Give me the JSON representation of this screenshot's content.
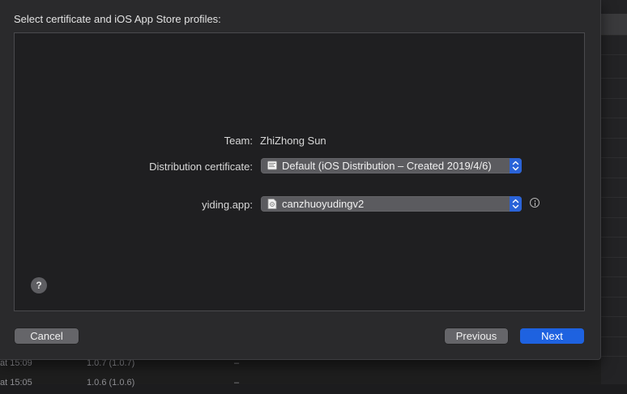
{
  "background_list": {
    "rows": [
      {
        "date": "at 15:09",
        "version": "1.0.7 (1.0.7)",
        "status": "–"
      },
      {
        "date": "at 15:05",
        "version": "1.0.6 (1.0.6)",
        "status": "–"
      }
    ]
  },
  "sheet": {
    "title": "Select certificate and iOS App Store profiles:",
    "team": {
      "label": "Team:",
      "value": "ZhiZhong Sun"
    },
    "distribution_certificate": {
      "label": "Distribution certificate:",
      "value": "Default (iOS Distribution – Created 2019/4/6)",
      "icon": "certificate-icon"
    },
    "app_profile": {
      "label": "yiding.app:",
      "value": "canzhuoyudingv2",
      "icon": "provisioning-profile-icon",
      "info_icon": "info-icon"
    },
    "help_label": "?",
    "buttons": {
      "cancel": "Cancel",
      "previous": "Previous",
      "next": "Next"
    }
  },
  "colors": {
    "accent": "#1e62e0",
    "sheet_bg": "#2a2a2c",
    "panel_bg": "#1f1f21"
  }
}
